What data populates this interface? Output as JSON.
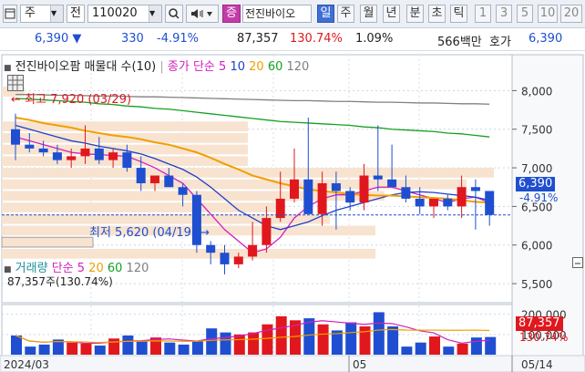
{
  "toolbar": {
    "type_label": "주",
    "mode_label": "전",
    "code": "110020",
    "name": "전진바이오",
    "periods": [
      "일",
      "주",
      "월",
      "년",
      "분",
      "초",
      "틱"
    ],
    "active_period": "일",
    "intervals": [
      "1",
      "3",
      "5",
      "10",
      "20"
    ]
  },
  "info": {
    "price": "6,390",
    "change": "330",
    "change_pct": "-4.91%",
    "volume": "87,357",
    "volume_ratio": "130.74%",
    "turnover": "1.09%",
    "amount": "566백만",
    "quote_label": "호가",
    "quote": "6,390"
  },
  "price_panel": {
    "title": "전진바이오팜 매물대 수(10)",
    "ma_label": "종가 단순",
    "ma_periods": [
      "5",
      "10",
      "20",
      "60",
      "120"
    ],
    "high_label": "최고 7,920 (03/29)",
    "low_label": "최저 5,620 (04/19)",
    "current_price": "6,390",
    "current_pct": "-4.91%"
  },
  "volume_panel": {
    "title": "거래량",
    "ma_label": "단순",
    "ma_periods": [
      "5",
      "20",
      "60",
      "120"
    ],
    "summary": "87,357주(130.74%)",
    "current_volume": "87,357",
    "current_pct": "130.74%"
  },
  "date_axis": {
    "labels": [
      "2024/03",
      "05",
      "05/14"
    ]
  },
  "colors": {
    "up": "#e0181e",
    "down": "#1f4fd0",
    "ma5": "#d21fbf",
    "ma10": "#1f3fc8",
    "ma20": "#f0a000",
    "ma60": "#14a020",
    "ma120": "#808080",
    "profile": "#f7e3d0"
  },
  "chart_data": [
    {
      "type": "candlestick",
      "title": "전진바이오팜 매물대 수(10)",
      "y_ticks": [
        8000,
        7500,
        7000,
        6500,
        6000,
        5500
      ],
      "ylim": [
        5300,
        8300
      ],
      "series": [
        {
          "name": "candles",
          "open": [
            7500,
            7300,
            7250,
            7200,
            7100,
            7150,
            7250,
            7100,
            7200,
            7000,
            6800,
            6900,
            6750,
            6650,
            6000,
            5900,
            5750,
            5850,
            6000,
            6350,
            6600,
            6850,
            6400,
            6800,
            6700,
            6550,
            6900,
            6850,
            6750,
            6600,
            6500,
            6600,
            6500,
            6750,
            6700
          ],
          "high": [
            7700,
            7450,
            7350,
            7300,
            7250,
            7550,
            7400,
            7250,
            7300,
            7150,
            6900,
            7000,
            6800,
            6700,
            6050,
            6000,
            5900,
            6300,
            6500,
            6950,
            7250,
            7650,
            6950,
            6950,
            6750,
            7050,
            7550,
            7300,
            6900,
            6750,
            6600,
            6650,
            6900,
            6850,
            6700
          ],
          "low": [
            7100,
            7200,
            7150,
            7050,
            7000,
            7050,
            7050,
            7000,
            6950,
            6700,
            6700,
            6750,
            6500,
            5900,
            5750,
            5620,
            5700,
            5800,
            5900,
            6300,
            6550,
            6650,
            6250,
            6200,
            6450,
            6450,
            6700,
            6750,
            6550,
            6400,
            6350,
            6450,
            6350,
            6200,
            6250
          ],
          "close": [
            7300,
            7250,
            7200,
            7100,
            7150,
            7250,
            7100,
            7200,
            7000,
            6800,
            6900,
            6750,
            6650,
            6000,
            5900,
            5750,
            5850,
            6000,
            6350,
            6600,
            6850,
            6400,
            6800,
            6700,
            6550,
            6900,
            6850,
            6750,
            6600,
            6500,
            6600,
            6500,
            6750,
            6700,
            6390
          ]
        },
        {
          "name": "5",
          "values": [
            7400,
            7350,
            7300,
            7250,
            7200,
            7180,
            7170,
            7160,
            7150,
            7080,
            7000,
            6900,
            6800,
            6600,
            6400,
            6200,
            6050,
            5900,
            5950,
            6100,
            6350,
            6500,
            6600,
            6650,
            6650,
            6700,
            6750,
            6750,
            6700,
            6650,
            6600,
            6550,
            6600,
            6620,
            6550
          ]
        },
        {
          "name": "10",
          "values": [
            7550,
            7500,
            7450,
            7400,
            7350,
            7320,
            7280,
            7250,
            7220,
            7180,
            7120,
            7050,
            6980,
            6880,
            6750,
            6600,
            6450,
            6350,
            6250,
            6200,
            6250,
            6300,
            6380,
            6450,
            6500,
            6550,
            6600,
            6650,
            6680,
            6690,
            6680,
            6660,
            6640,
            6620,
            6580
          ]
        },
        {
          "name": "20",
          "values": [
            7650,
            7620,
            7580,
            7550,
            7520,
            7480,
            7450,
            7420,
            7400,
            7370,
            7330,
            7300,
            7250,
            7200,
            7130,
            7050,
            6980,
            6900,
            6850,
            6800,
            6760,
            6720,
            6700,
            6680,
            6660,
            6650,
            6640,
            6640,
            6630,
            6620,
            6610,
            6600,
            6580,
            6560,
            6550
          ]
        },
        {
          "name": "60",
          "values": [
            7900,
            7890,
            7880,
            7870,
            7860,
            7850,
            7830,
            7820,
            7800,
            7790,
            7770,
            7760,
            7740,
            7720,
            7700,
            7680,
            7660,
            7640,
            7620,
            7600,
            7590,
            7580,
            7570,
            7560,
            7550,
            7530,
            7520,
            7500,
            7490,
            7480,
            7470,
            7450,
            7440,
            7420,
            7400
          ]
        },
        {
          "name": "120",
          "values": [
            7950,
            7950,
            7945,
            7940,
            7940,
            7935,
            7930,
            7930,
            7925,
            7920,
            7920,
            7915,
            7910,
            7905,
            7900,
            7895,
            7890,
            7885,
            7880,
            7875,
            7870,
            7870,
            7865,
            7860,
            7860,
            7855,
            7850,
            7850,
            7845,
            7840,
            7840,
            7835,
            7830,
            7830,
            7825
          ]
        }
      ]
    },
    {
      "type": "bar",
      "title": "거래량",
      "y_ticks": [
        200000,
        100000
      ],
      "ylim": [
        0,
        230000
      ],
      "values": [
        95000,
        40000,
        50000,
        75000,
        60000,
        55000,
        45000,
        80000,
        95000,
        70000,
        85000,
        60000,
        50000,
        70000,
        130000,
        110000,
        100000,
        110000,
        150000,
        190000,
        170000,
        180000,
        150000,
        120000,
        160000,
        140000,
        210000,
        140000,
        40000,
        60000,
        90000,
        40000,
        55000,
        85000,
        87357
      ]
    }
  ]
}
